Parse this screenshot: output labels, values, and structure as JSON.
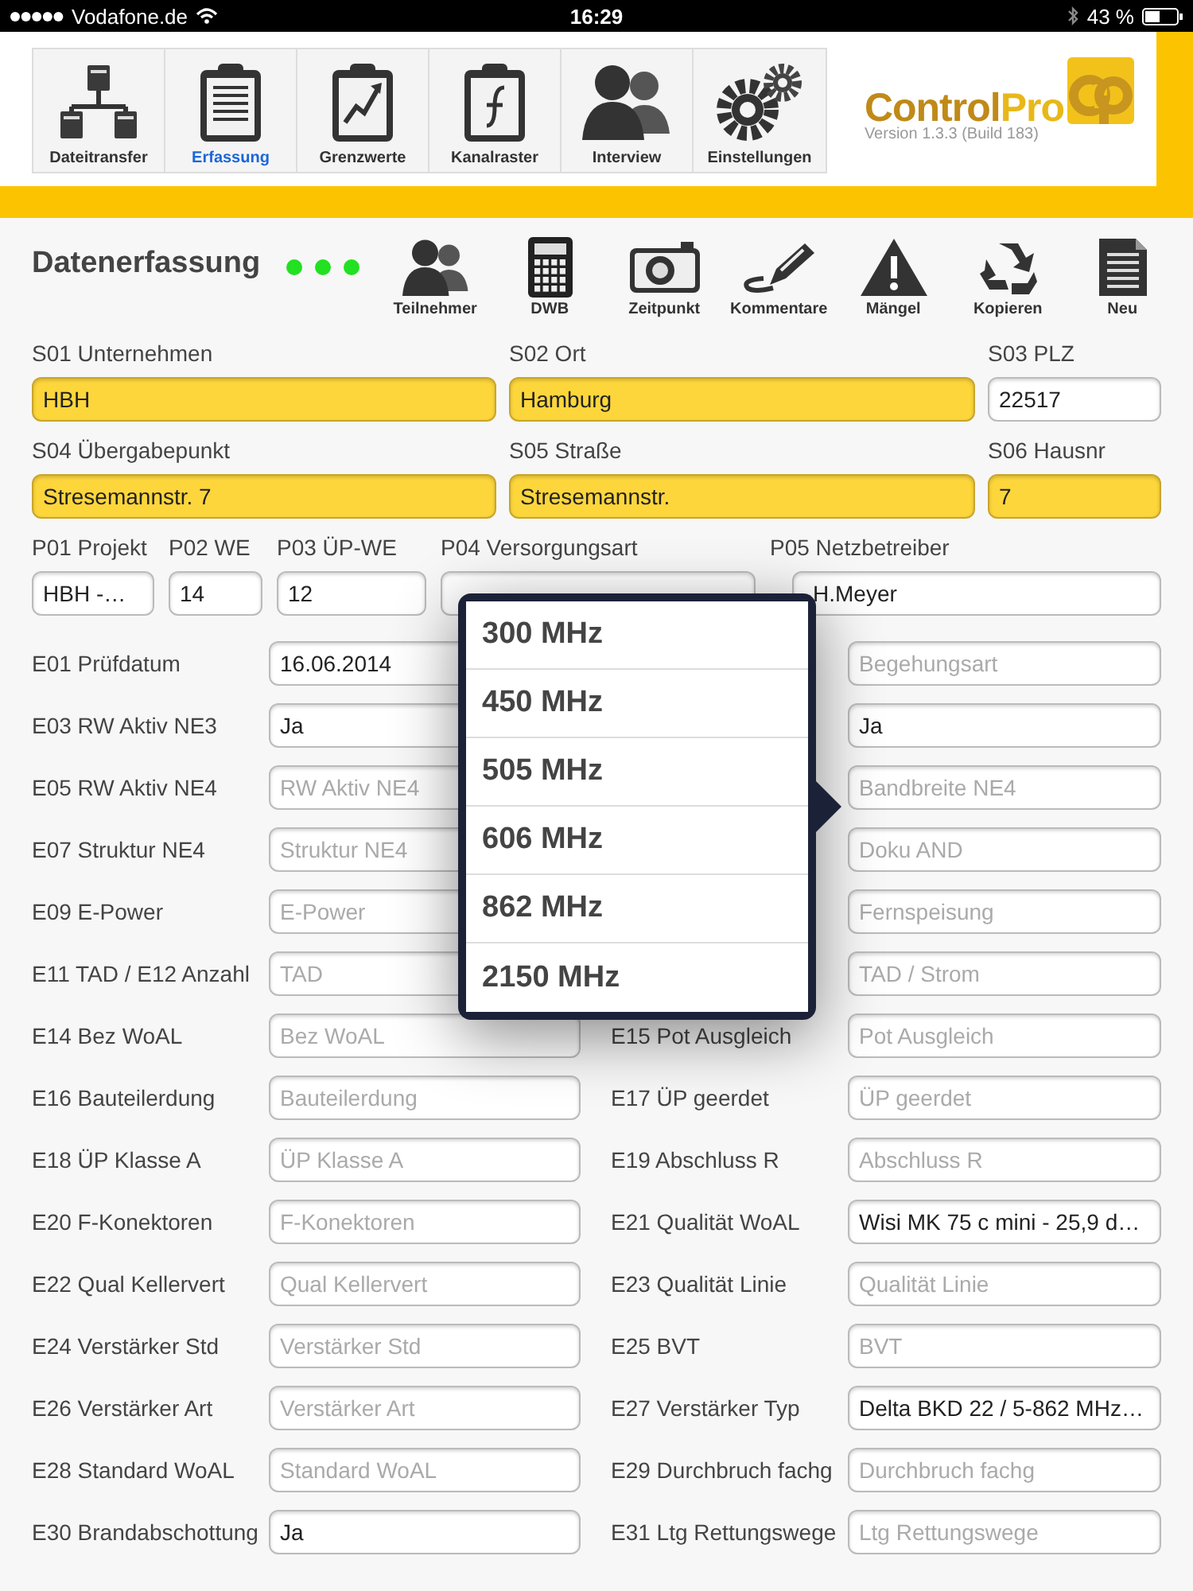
{
  "status_bar": {
    "carrier": "Vodafone.de",
    "time": "16:29",
    "battery": "43 %"
  },
  "nav": [
    {
      "label": "Dateitransfer",
      "selected": false
    },
    {
      "label": "Erfassung",
      "selected": true
    },
    {
      "label": "Grenzwerte",
      "selected": false
    },
    {
      "label": "Kanalraster",
      "selected": false
    },
    {
      "label": "Interview",
      "selected": false
    },
    {
      "label": "Einstellungen",
      "selected": false
    }
  ],
  "logo": {
    "brand": [
      "Control",
      "Pro"
    ],
    "version": "Version 1.3.3 (Build 183)"
  },
  "page_title": "Datenerfassung",
  "status_dots": [
    {
      "color": "#22e022"
    },
    {
      "color": "#22e022"
    },
    {
      "color": "#22e022"
    }
  ],
  "toolbar": [
    {
      "label": "Teilnehmer"
    },
    {
      "label": "DWB"
    },
    {
      "label": "Zeitpunkt"
    },
    {
      "label": "Kommentare"
    },
    {
      "label": "Mängel"
    },
    {
      "label": "Kopieren"
    },
    {
      "label": "Neu"
    }
  ],
  "site_fields": [
    {
      "label": "S01 Unternehmen",
      "value": "HBH",
      "highlighted": true
    },
    {
      "label": "S02 Ort",
      "value": "Hamburg",
      "highlighted": true
    },
    {
      "label": "S03 PLZ",
      "value": "22517",
      "highlighted": false
    },
    {
      "label": "S04 Übergabepunkt",
      "value": "Stresemannstr. 7",
      "highlighted": true
    },
    {
      "label": "S05 Straße",
      "value": "Stresemannstr.",
      "highlighted": true
    },
    {
      "label": "S06 Hausnr",
      "value": "7",
      "highlighted": true
    }
  ],
  "project_fields": [
    {
      "label": "P01 Projekt",
      "value": "HBH -…"
    },
    {
      "label": "P02 WE",
      "value": "14"
    },
    {
      "label": "P03 ÜP-WE",
      "value": "12"
    },
    {
      "label": "P04 Versorgungsart"
    },
    {
      "label": "P05 Netzbetreiber",
      "value": "H.Meyer"
    }
  ],
  "rows": [
    {
      "left": {
        "label": "E01 Prüfdatum",
        "value": "16.06.2014"
      },
      "right": {
        "placeholder": "Begehungsart"
      }
    },
    {
      "left": {
        "label": "E03 RW Aktiv NE3",
        "value": "Ja"
      },
      "right": {
        "value": "Ja"
      }
    },
    {
      "left": {
        "label": "E05 RW Aktiv NE4",
        "placeholder": "RW Aktiv NE4"
      },
      "right": {
        "placeholder": "Bandbreite NE4"
      }
    },
    {
      "left": {
        "label": "E07 Struktur NE4",
        "placeholder": "Struktur NE4"
      },
      "right": {
        "placeholder": "Doku AND"
      }
    },
    {
      "left": {
        "label": "E09 E-Power",
        "placeholder": "E-Power"
      },
      "right": {
        "placeholder": "Fernspeisung"
      }
    },
    {
      "left": {
        "label": "E11 TAD / E12 Anzahl",
        "placeholder": "TAD"
      },
      "right": {
        "placeholder": "TAD / Strom"
      }
    },
    {
      "left": {
        "label": "E14 Bez WoAL",
        "placeholder": "Bez WoAL"
      },
      "right": {
        "label": "E15 Pot Ausgleich",
        "placeholder": "Pot Ausgleich"
      }
    },
    {
      "left": {
        "label": "E16 Bauteilerdung",
        "placeholder": "Bauteilerdung"
      },
      "right": {
        "label": "E17 ÜP geerdet",
        "placeholder": "ÜP geerdet"
      }
    },
    {
      "left": {
        "label": "E18 ÜP Klasse A",
        "placeholder": "ÜP Klasse A"
      },
      "right": {
        "label": "E19 Abschluss R",
        "placeholder": "Abschluss R"
      }
    },
    {
      "left": {
        "label": "E20 F-Konektoren",
        "placeholder": "F-Konektoren"
      },
      "right": {
        "label": "E21 Qualität WoAL",
        "value": "Wisi MK 75 c mini - 25,9 d…"
      }
    },
    {
      "left": {
        "label": "E22 Qual Kellervert",
        "placeholder": "Qual Kellervert"
      },
      "right": {
        "label": "E23 Qualität Linie",
        "placeholder": "Qualität Linie"
      }
    },
    {
      "left": {
        "label": "E24 Verstärker Std",
        "placeholder": "Verstärker Std"
      },
      "right": {
        "label": "E25 BVT",
        "placeholder": "BVT"
      }
    },
    {
      "left": {
        "label": "E26 Verstärker Art",
        "placeholder": "Verstärker Art"
      },
      "right": {
        "label": "E27 Verstärker Typ",
        "value": "Delta BKD 22 / 5-862 MHz…"
      }
    },
    {
      "left": {
        "label": "E28 Standard WoAL",
        "placeholder": "Standard WoAL"
      },
      "right": {
        "label": "E29 Durchbruch fachg",
        "placeholder": "Durchbruch fachg"
      }
    },
    {
      "left": {
        "label": "E30 Brandabschottung",
        "value": "Ja"
      },
      "right": {
        "label": "E31 Ltg Rettungswege",
        "placeholder": "Ltg Rettungswege"
      }
    }
  ],
  "popover": {
    "options": [
      {
        "label": "300 MHz",
        "selected": false
      },
      {
        "label": "450 MHz",
        "selected": false
      },
      {
        "label": "505 MHz",
        "selected": false
      },
      {
        "label": "606 MHz",
        "selected": false
      },
      {
        "label": "862 MHz",
        "selected": false
      },
      {
        "label": "2150 MHz",
        "selected": false
      }
    ]
  }
}
